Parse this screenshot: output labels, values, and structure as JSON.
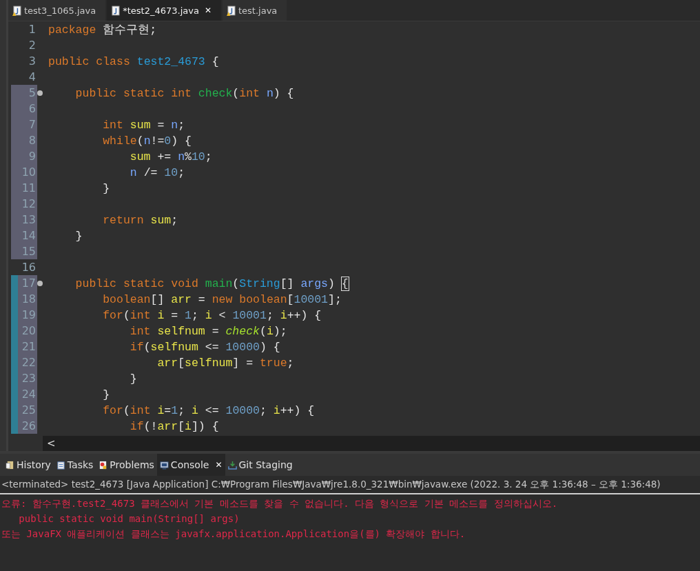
{
  "editor_tabs": [
    {
      "label": "test3_1065.java",
      "selected": false,
      "warning": true
    },
    {
      "label": "*test2_4673.java",
      "selected": true,
      "warning": false,
      "close": "✕"
    },
    {
      "label": "test.java",
      "selected": false,
      "warning": true
    }
  ],
  "code_lines": [
    {
      "number": "1",
      "shaded": false,
      "changed": false,
      "foldable": false,
      "tokens": [
        {
          "kind": "kw",
          "text": "package"
        },
        {
          "kind": "plain",
          "text": " 함수구현;"
        }
      ]
    },
    {
      "number": "2",
      "shaded": false,
      "changed": false,
      "foldable": false
    },
    {
      "number": "3",
      "shaded": false,
      "changed": false,
      "foldable": false,
      "tokens": [
        {
          "kind": "kw",
          "text": "public class "
        },
        {
          "kind": "cls",
          "text": "test2_4673"
        },
        {
          "kind": "plain",
          "text": " {"
        }
      ]
    },
    {
      "number": "4",
      "shaded": false,
      "changed": false,
      "foldable": false
    },
    {
      "number": "5",
      "shaded": true,
      "changed": false,
      "foldable": true,
      "tokens": [
        {
          "kind": "kw",
          "text": "    public static int "
        },
        {
          "kind": "method",
          "text": "check"
        },
        {
          "kind": "plain",
          "text": "("
        },
        {
          "kind": "kw",
          "text": "int "
        },
        {
          "kind": "param",
          "text": "n"
        },
        {
          "kind": "plain",
          "text": ") {"
        }
      ]
    },
    {
      "number": "6",
      "shaded": true,
      "changed": false,
      "foldable": false
    },
    {
      "number": "7",
      "shaded": true,
      "changed": false,
      "foldable": false,
      "tokens": [
        {
          "kind": "kw",
          "text": "        int "
        },
        {
          "kind": "var",
          "text": "sum"
        },
        {
          "kind": "plain",
          "text": " = "
        },
        {
          "kind": "param",
          "text": "n"
        },
        {
          "kind": "plain",
          "text": ";"
        }
      ]
    },
    {
      "number": "8",
      "shaded": true,
      "changed": false,
      "foldable": false,
      "tokens": [
        {
          "kind": "kw",
          "text": "        while"
        },
        {
          "kind": "plain",
          "text": "("
        },
        {
          "kind": "param",
          "text": "n"
        },
        {
          "kind": "plain",
          "text": "!="
        },
        {
          "kind": "num",
          "text": "0"
        },
        {
          "kind": "plain",
          "text": ") {"
        }
      ]
    },
    {
      "number": "9",
      "shaded": true,
      "changed": false,
      "foldable": false,
      "tokens": [
        {
          "kind": "var",
          "text": "            sum"
        },
        {
          "kind": "plain",
          "text": " += "
        },
        {
          "kind": "param",
          "text": "n"
        },
        {
          "kind": "plain",
          "text": "%"
        },
        {
          "kind": "num",
          "text": "10"
        },
        {
          "kind": "plain",
          "text": ";"
        }
      ]
    },
    {
      "number": "10",
      "shaded": true,
      "changed": false,
      "foldable": false,
      "tokens": [
        {
          "kind": "param",
          "text": "            n"
        },
        {
          "kind": "plain",
          "text": " /= "
        },
        {
          "kind": "num",
          "text": "10"
        },
        {
          "kind": "plain",
          "text": ";"
        }
      ]
    },
    {
      "number": "11",
      "shaded": true,
      "changed": false,
      "foldable": false,
      "tokens": [
        {
          "kind": "plain",
          "text": "        }"
        }
      ]
    },
    {
      "number": "12",
      "shaded": true,
      "changed": false,
      "foldable": false
    },
    {
      "number": "13",
      "shaded": true,
      "changed": false,
      "foldable": false,
      "tokens": [
        {
          "kind": "kw",
          "text": "        return "
        },
        {
          "kind": "var",
          "text": "sum"
        },
        {
          "kind": "plain",
          "text": ";"
        }
      ]
    },
    {
      "number": "14",
      "shaded": true,
      "changed": false,
      "foldable": false,
      "tokens": [
        {
          "kind": "plain",
          "text": "    }"
        }
      ]
    },
    {
      "number": "15",
      "shaded": true,
      "changed": false,
      "foldable": false
    },
    {
      "number": "16",
      "shaded": false,
      "changed": false,
      "foldable": false
    },
    {
      "number": "17",
      "shaded": true,
      "changed": true,
      "foldable": true,
      "tokens": [
        {
          "kind": "kw",
          "text": "    public static void "
        },
        {
          "kind": "method",
          "text": "main"
        },
        {
          "kind": "plain",
          "text": "("
        },
        {
          "kind": "cls",
          "text": "String"
        },
        {
          "kind": "plain",
          "text": "[] "
        },
        {
          "kind": "param",
          "text": "args"
        },
        {
          "kind": "plain",
          "text": ") "
        },
        {
          "kind": "bracket",
          "text": "{"
        }
      ]
    },
    {
      "number": "18",
      "shaded": true,
      "changed": true,
      "foldable": false,
      "tokens": [
        {
          "kind": "kw",
          "text": "        boolean"
        },
        {
          "kind": "plain",
          "text": "[] "
        },
        {
          "kind": "var",
          "text": "arr"
        },
        {
          "kind": "plain",
          "text": " = "
        },
        {
          "kind": "kw",
          "text": "new boolean"
        },
        {
          "kind": "plain",
          "text": "["
        },
        {
          "kind": "num",
          "text": "10001"
        },
        {
          "kind": "plain",
          "text": "];"
        }
      ]
    },
    {
      "number": "19",
      "shaded": true,
      "changed": true,
      "foldable": false,
      "tokens": [
        {
          "kind": "kw",
          "text": "        for"
        },
        {
          "kind": "plain",
          "text": "("
        },
        {
          "kind": "kw",
          "text": "int "
        },
        {
          "kind": "var",
          "text": "i"
        },
        {
          "kind": "plain",
          "text": " = "
        },
        {
          "kind": "num",
          "text": "1"
        },
        {
          "kind": "plain",
          "text": "; "
        },
        {
          "kind": "var",
          "text": "i"
        },
        {
          "kind": "plain",
          "text": " < "
        },
        {
          "kind": "num",
          "text": "10001"
        },
        {
          "kind": "plain",
          "text": "; "
        },
        {
          "kind": "var",
          "text": "i"
        },
        {
          "kind": "plain",
          "text": "++) {"
        }
      ]
    },
    {
      "number": "20",
      "shaded": true,
      "changed": true,
      "foldable": false,
      "tokens": [
        {
          "kind": "kw",
          "text": "            int "
        },
        {
          "kind": "var",
          "text": "selfnum"
        },
        {
          "kind": "plain",
          "text": " = "
        },
        {
          "kind": "italic",
          "text": "check"
        },
        {
          "kind": "plain",
          "text": "("
        },
        {
          "kind": "var",
          "text": "i"
        },
        {
          "kind": "plain",
          "text": ");"
        }
      ]
    },
    {
      "number": "21",
      "shaded": true,
      "changed": true,
      "foldable": false,
      "tokens": [
        {
          "kind": "kw",
          "text": "            if"
        },
        {
          "kind": "plain",
          "text": "("
        },
        {
          "kind": "var",
          "text": "selfnum"
        },
        {
          "kind": "plain",
          "text": " <= "
        },
        {
          "kind": "num",
          "text": "10000"
        },
        {
          "kind": "plain",
          "text": ") {"
        }
      ]
    },
    {
      "number": "22",
      "shaded": true,
      "changed": true,
      "foldable": false,
      "tokens": [
        {
          "kind": "var",
          "text": "                arr"
        },
        {
          "kind": "plain",
          "text": "["
        },
        {
          "kind": "var",
          "text": "selfnum"
        },
        {
          "kind": "plain",
          "text": "] = "
        },
        {
          "kind": "kw",
          "text": "true"
        },
        {
          "kind": "plain",
          "text": ";"
        }
      ]
    },
    {
      "number": "23",
      "shaded": true,
      "changed": true,
      "foldable": false,
      "tokens": [
        {
          "kind": "plain",
          "text": "            }"
        }
      ]
    },
    {
      "number": "24",
      "shaded": true,
      "changed": true,
      "foldable": false,
      "tokens": [
        {
          "kind": "plain",
          "text": "        }"
        }
      ]
    },
    {
      "number": "25",
      "shaded": true,
      "changed": true,
      "foldable": false,
      "tokens": [
        {
          "kind": "kw",
          "text": "        for"
        },
        {
          "kind": "plain",
          "text": "("
        },
        {
          "kind": "kw",
          "text": "int "
        },
        {
          "kind": "var",
          "text": "i"
        },
        {
          "kind": "plain",
          "text": "="
        },
        {
          "kind": "num",
          "text": "1"
        },
        {
          "kind": "plain",
          "text": "; "
        },
        {
          "kind": "var",
          "text": "i"
        },
        {
          "kind": "plain",
          "text": " <= "
        },
        {
          "kind": "num",
          "text": "10000"
        },
        {
          "kind": "plain",
          "text": "; "
        },
        {
          "kind": "var",
          "text": "i"
        },
        {
          "kind": "plain",
          "text": "++) {"
        }
      ]
    },
    {
      "number": "26",
      "shaded": true,
      "changed": true,
      "foldable": false,
      "tokens": [
        {
          "kind": "kw",
          "text": "            if"
        },
        {
          "kind": "plain",
          "text": "(!"
        },
        {
          "kind": "var",
          "text": "arr"
        },
        {
          "kind": "plain",
          "text": "["
        },
        {
          "kind": "var",
          "text": "i"
        },
        {
          "kind": "plain",
          "text": "]) {"
        }
      ]
    }
  ],
  "scroll_arrow": "<",
  "panel_tabs": [
    {
      "label": "History",
      "selected": false
    },
    {
      "label": "Tasks",
      "selected": false
    },
    {
      "label": "Problems",
      "selected": false
    },
    {
      "label": "Console",
      "selected": true,
      "close": "✕"
    },
    {
      "label": "Git Staging",
      "selected": false
    }
  ],
  "console": {
    "header": "<terminated> test2_4673 [Java Application] C:₩Program Files₩Java₩jre1.8.0_321₩bin₩javaw.exe  (2022. 3. 24 오후 1:36:48 – 오후 1:36:48)",
    "lines": [
      "오류: 함수구현.test2_4673 클래스에서 기본 메소드를 찾을 수 없습니다. 다음 형식으로 기본 메소드를 정의하십시오.",
      "   public static void main(String[] args)",
      "또는 JavaFX 애플리케이션 클래스는 javafx.application.Application을(를) 확장해야 합니다."
    ]
  }
}
